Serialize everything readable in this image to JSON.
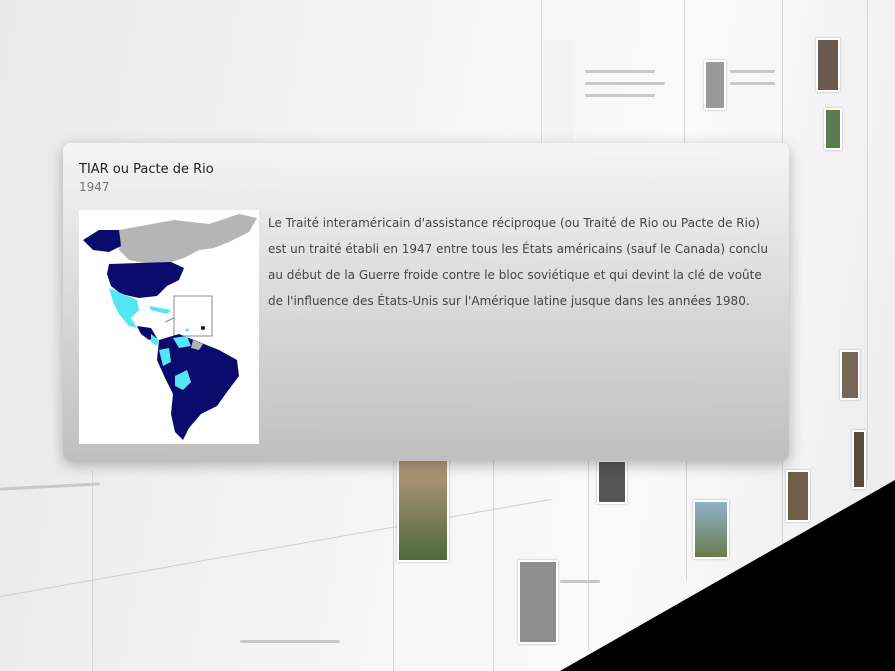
{
  "popup": {
    "title": "TIAR ou Pacte de Rio",
    "year": "1947",
    "description": "Le Traité interaméricain d'assistance réciproque (ou Traité de Rio ou Pacte de Rio) est un traité établi en 1947 entre tous les États américains (sauf le Canada) conclu au début de la Guerre froide contre le bloc soviétique et qui devint la clé de voûte de l'in­fluence des États-Unis sur l'Amérique latine jusque dans les années 1980.",
    "map_icon": "americas-map-icon"
  },
  "colors": {
    "member": "#0b0b6e",
    "former_member": "#54e6f2",
    "non_member": "#b5b5b5"
  }
}
